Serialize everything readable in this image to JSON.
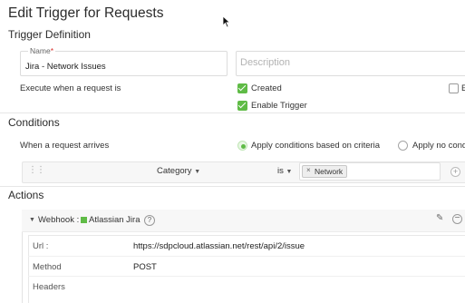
{
  "header": {
    "title": "Edit Trigger for Requests"
  },
  "trigger_definition": {
    "heading": "Trigger Definition",
    "name": {
      "label": "Name",
      "required_mark": "*",
      "value": "Jira - Network Issues"
    },
    "description": {
      "placeholder": "Description"
    },
    "execute_label": "Execute when a request is",
    "checkboxes": [
      {
        "label": "Created",
        "checked": true
      },
      {
        "label": "Enable Trigger",
        "checked": true
      },
      {
        "label": "E",
        "checked": false
      }
    ]
  },
  "conditions": {
    "heading": "Conditions",
    "when_label": "When a request arrives",
    "options": [
      {
        "label": "Apply conditions based on criteria",
        "selected": true
      },
      {
        "label": "Apply no cond",
        "selected": false
      }
    ],
    "criteria": {
      "field": "Category",
      "operator": "is",
      "value_token": "Network",
      "token_remove": "×"
    }
  },
  "actions": {
    "heading": "Actions",
    "webhook": {
      "type_label": "Webhook :",
      "name": "Atlassian Jira",
      "help": "?",
      "rows": [
        {
          "key": "Url :",
          "value": "https://sdpcloud.atlassian.net/rest/api/2/issue"
        },
        {
          "key": "Method",
          "value": "POST"
        },
        {
          "key": "Headers",
          "value": ""
        }
      ]
    }
  },
  "colors": {
    "accent_green": "#5fbb46",
    "required_red": "#d9302c"
  }
}
